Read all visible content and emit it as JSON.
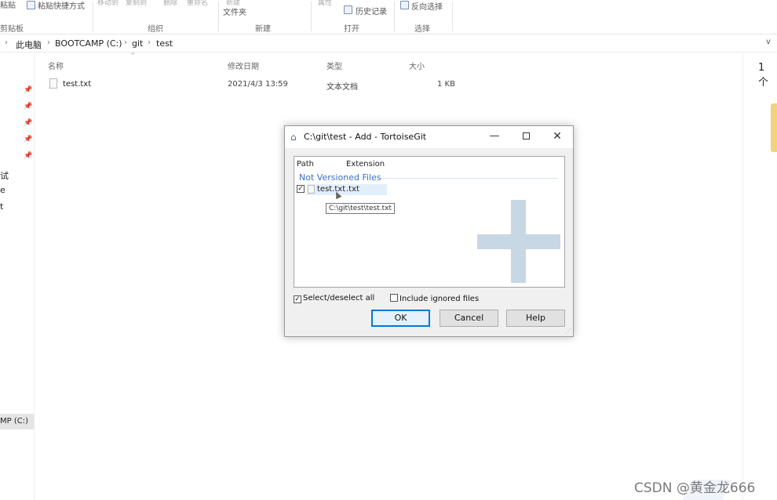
{
  "ribbon": {
    "paste_label": "粘贴",
    "paste_shortcut_label": "粘贴快捷方式",
    "move_to_label": "移动到",
    "copy_to_label": "复制到",
    "delete_label": "删除",
    "rename_label": "重命名",
    "new_label": "新建",
    "new_folder_label": "文件夹",
    "properties_label": "属性",
    "history_label": "历史记录",
    "invert_selection_label": "反向选择",
    "groups": {
      "clipboard": "剪贴板",
      "organize": "组织",
      "new": "新建",
      "open": "打开",
      "select": "选择"
    }
  },
  "breadcrumb": {
    "items": [
      "此电脑",
      "BOOTCAMP (C:)",
      "git",
      "test"
    ],
    "separator": "›"
  },
  "navpane": {
    "fragments": [
      "试",
      "e",
      "t"
    ],
    "drive_label": "MP (C:)"
  },
  "filelist": {
    "columns": {
      "name": "名称",
      "modified": "修改日期",
      "type": "类型",
      "size": "大小"
    },
    "rows": [
      {
        "name": "test.txt",
        "modified": "2021/4/3 13:59",
        "type": "文本文档",
        "size": "1 KB"
      }
    ],
    "item_count": "1 个"
  },
  "dialog": {
    "title": "C:\\git\\test - Add - TortoiseGit",
    "list_columns": {
      "path": "Path",
      "extension": "Extension"
    },
    "group_label": "Not Versioned Files",
    "files": [
      {
        "name": "test.txt",
        "extension": ".txt",
        "checked": true
      }
    ],
    "tooltip": "C:\\git\\test\\test.txt",
    "select_all_label": "Select/deselect all",
    "select_all_checked": true,
    "include_ignored_label": "Include ignored files",
    "include_ignored_checked": false,
    "ok_label": "OK",
    "cancel_label": "Cancel",
    "help_label": "Help",
    "check_glyph": "✓"
  },
  "watermark": {
    "text": "CSDN @黄金龙666"
  },
  "colors": {
    "link_blue": "#3b6fc9",
    "plus_icon": "#c7d7e3",
    "focus_blue": "#0078d7",
    "folder_yellow": "#f4d27a"
  }
}
